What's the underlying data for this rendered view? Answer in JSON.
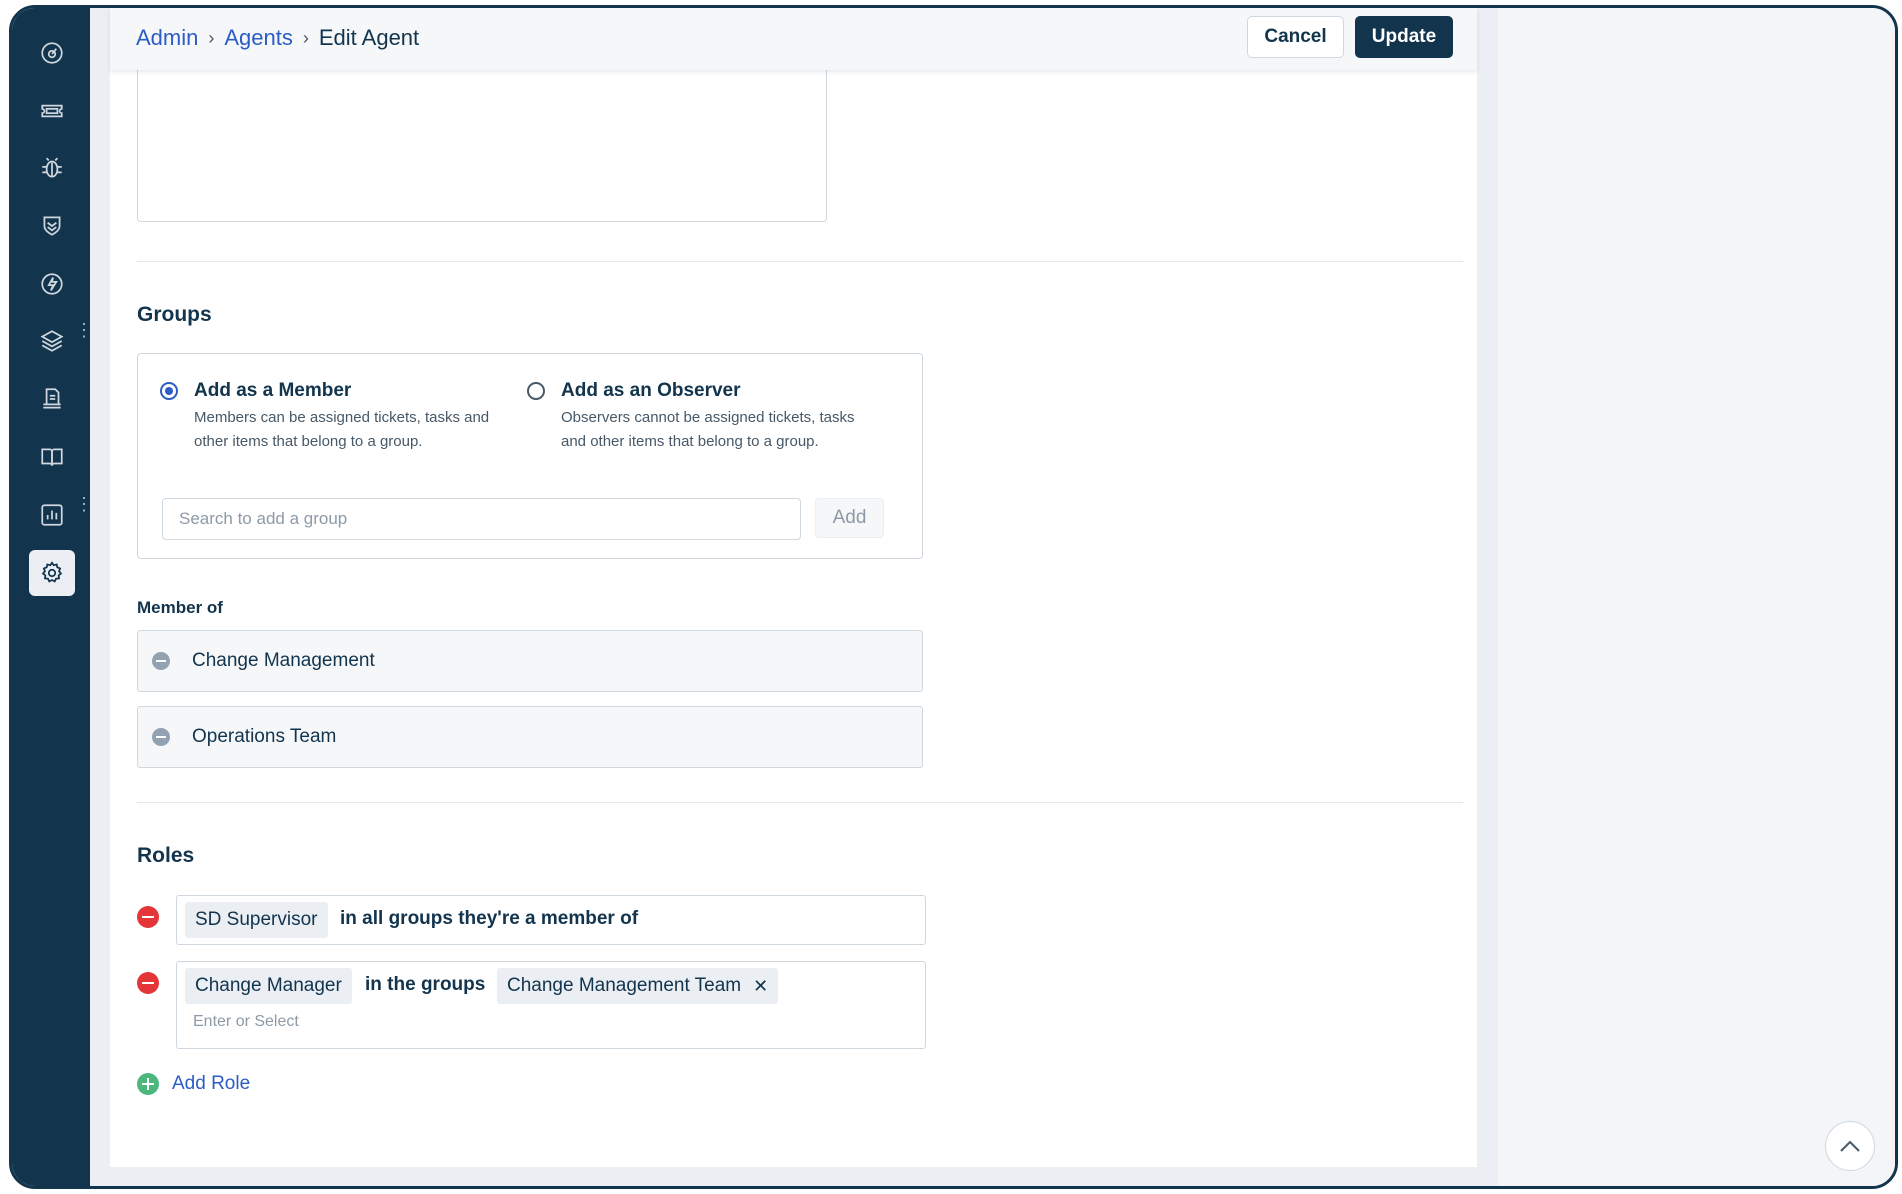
{
  "breadcrumb": {
    "items": [
      "Admin",
      "Agents"
    ],
    "current": "Edit Agent"
  },
  "actions": {
    "cancel_label": "Cancel",
    "update_label": "Update"
  },
  "sidebar": {
    "icons": [
      "dashboard-icon",
      "tickets-icon",
      "problems-icon",
      "changes-icon",
      "releases-icon",
      "assets-icon",
      "projects-icon",
      "solutions-icon",
      "analytics-icon",
      "settings-icon"
    ],
    "active": "settings-icon"
  },
  "groups": {
    "title": "Groups",
    "member_option": {
      "title": "Add as a Member",
      "description": "Members can be assigned tickets, tasks and other items that belong to a group.",
      "selected": true
    },
    "observer_option": {
      "title": "Add as an Observer",
      "description": "Observers cannot be assigned tickets, tasks and other items that belong to a group.",
      "selected": false
    },
    "search_placeholder": "Search to add a group",
    "add_label": "Add",
    "member_of_label": "Member of",
    "members": [
      "Change Management",
      "Operations Team"
    ]
  },
  "roles": {
    "title": "Roles",
    "items": [
      {
        "role": "SD Supervisor",
        "scope": "in all groups they're a member of"
      },
      {
        "role": "Change Manager",
        "scope": "in the groups",
        "groups": [
          "Change Management Team"
        ],
        "placeholder": "Enter or Select"
      }
    ],
    "add_label": "Add Role"
  },
  "colors": {
    "sidebar": "#12344d",
    "link": "#2c5cc5",
    "primary": "#12344d",
    "danger": "#e43538",
    "success": "#4bb77c"
  }
}
